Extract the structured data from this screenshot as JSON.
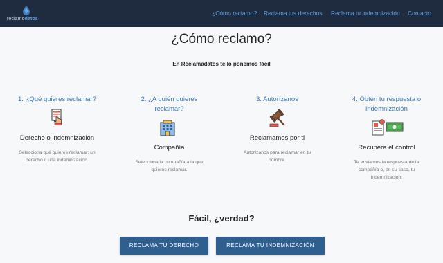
{
  "brand": {
    "name_plain": "reclamo",
    "name_bold": "datos",
    "accent": "#5aa0e6"
  },
  "nav": {
    "links": [
      "¿Cómo reclamo?",
      "Reclama tus derechos",
      "Reclama tu indemnización",
      "Contacto"
    ]
  },
  "main": {
    "title": "¿Cómo reclamo?",
    "subtitle": "En Reclamadatos te lo ponemos fácil",
    "steps": [
      {
        "title": "1. ¿Qué quieres reclamar?",
        "icon": "hand-document-icon",
        "heading": "Derecho o indemnización",
        "desc_lines": [
          "Selecciona qué quieres reclamar: un",
          "derecho o una indemnización."
        ]
      },
      {
        "title_lines": [
          "2. ¿A quién quieres",
          "reclamar?"
        ],
        "icon": "building-icon",
        "heading": "Compañía",
        "desc_lines": [
          "Selecciona la compañía a la que",
          "quieres reclamar."
        ]
      },
      {
        "title": "3. Autorízanos",
        "icon": "gavel-icon",
        "heading": "Reclamamos por ti",
        "desc_lines": [
          "Autorízanos para reclamar en tu",
          "nombre."
        ]
      },
      {
        "title_lines": [
          "4. Obtén tu respuesta o",
          "indemnización"
        ],
        "icon": "money-transfer-icon",
        "heading": "Recupera el control",
        "desc_lines": [
          "Te enviamos la respuesta de la",
          "compañía o, en su caso, tu",
          "indemnización."
        ]
      }
    ],
    "cta": "Fácil, ¿verdad?",
    "buttons": [
      "RECLAMA TU DERECHO",
      "RECLAMA TU INDEMNIZACIÓN"
    ]
  },
  "colors": {
    "nav_bg": "#1f2b3e",
    "link": "#5fa2e6",
    "step_title": "#3a78b8",
    "button": "#2f5f8f"
  }
}
